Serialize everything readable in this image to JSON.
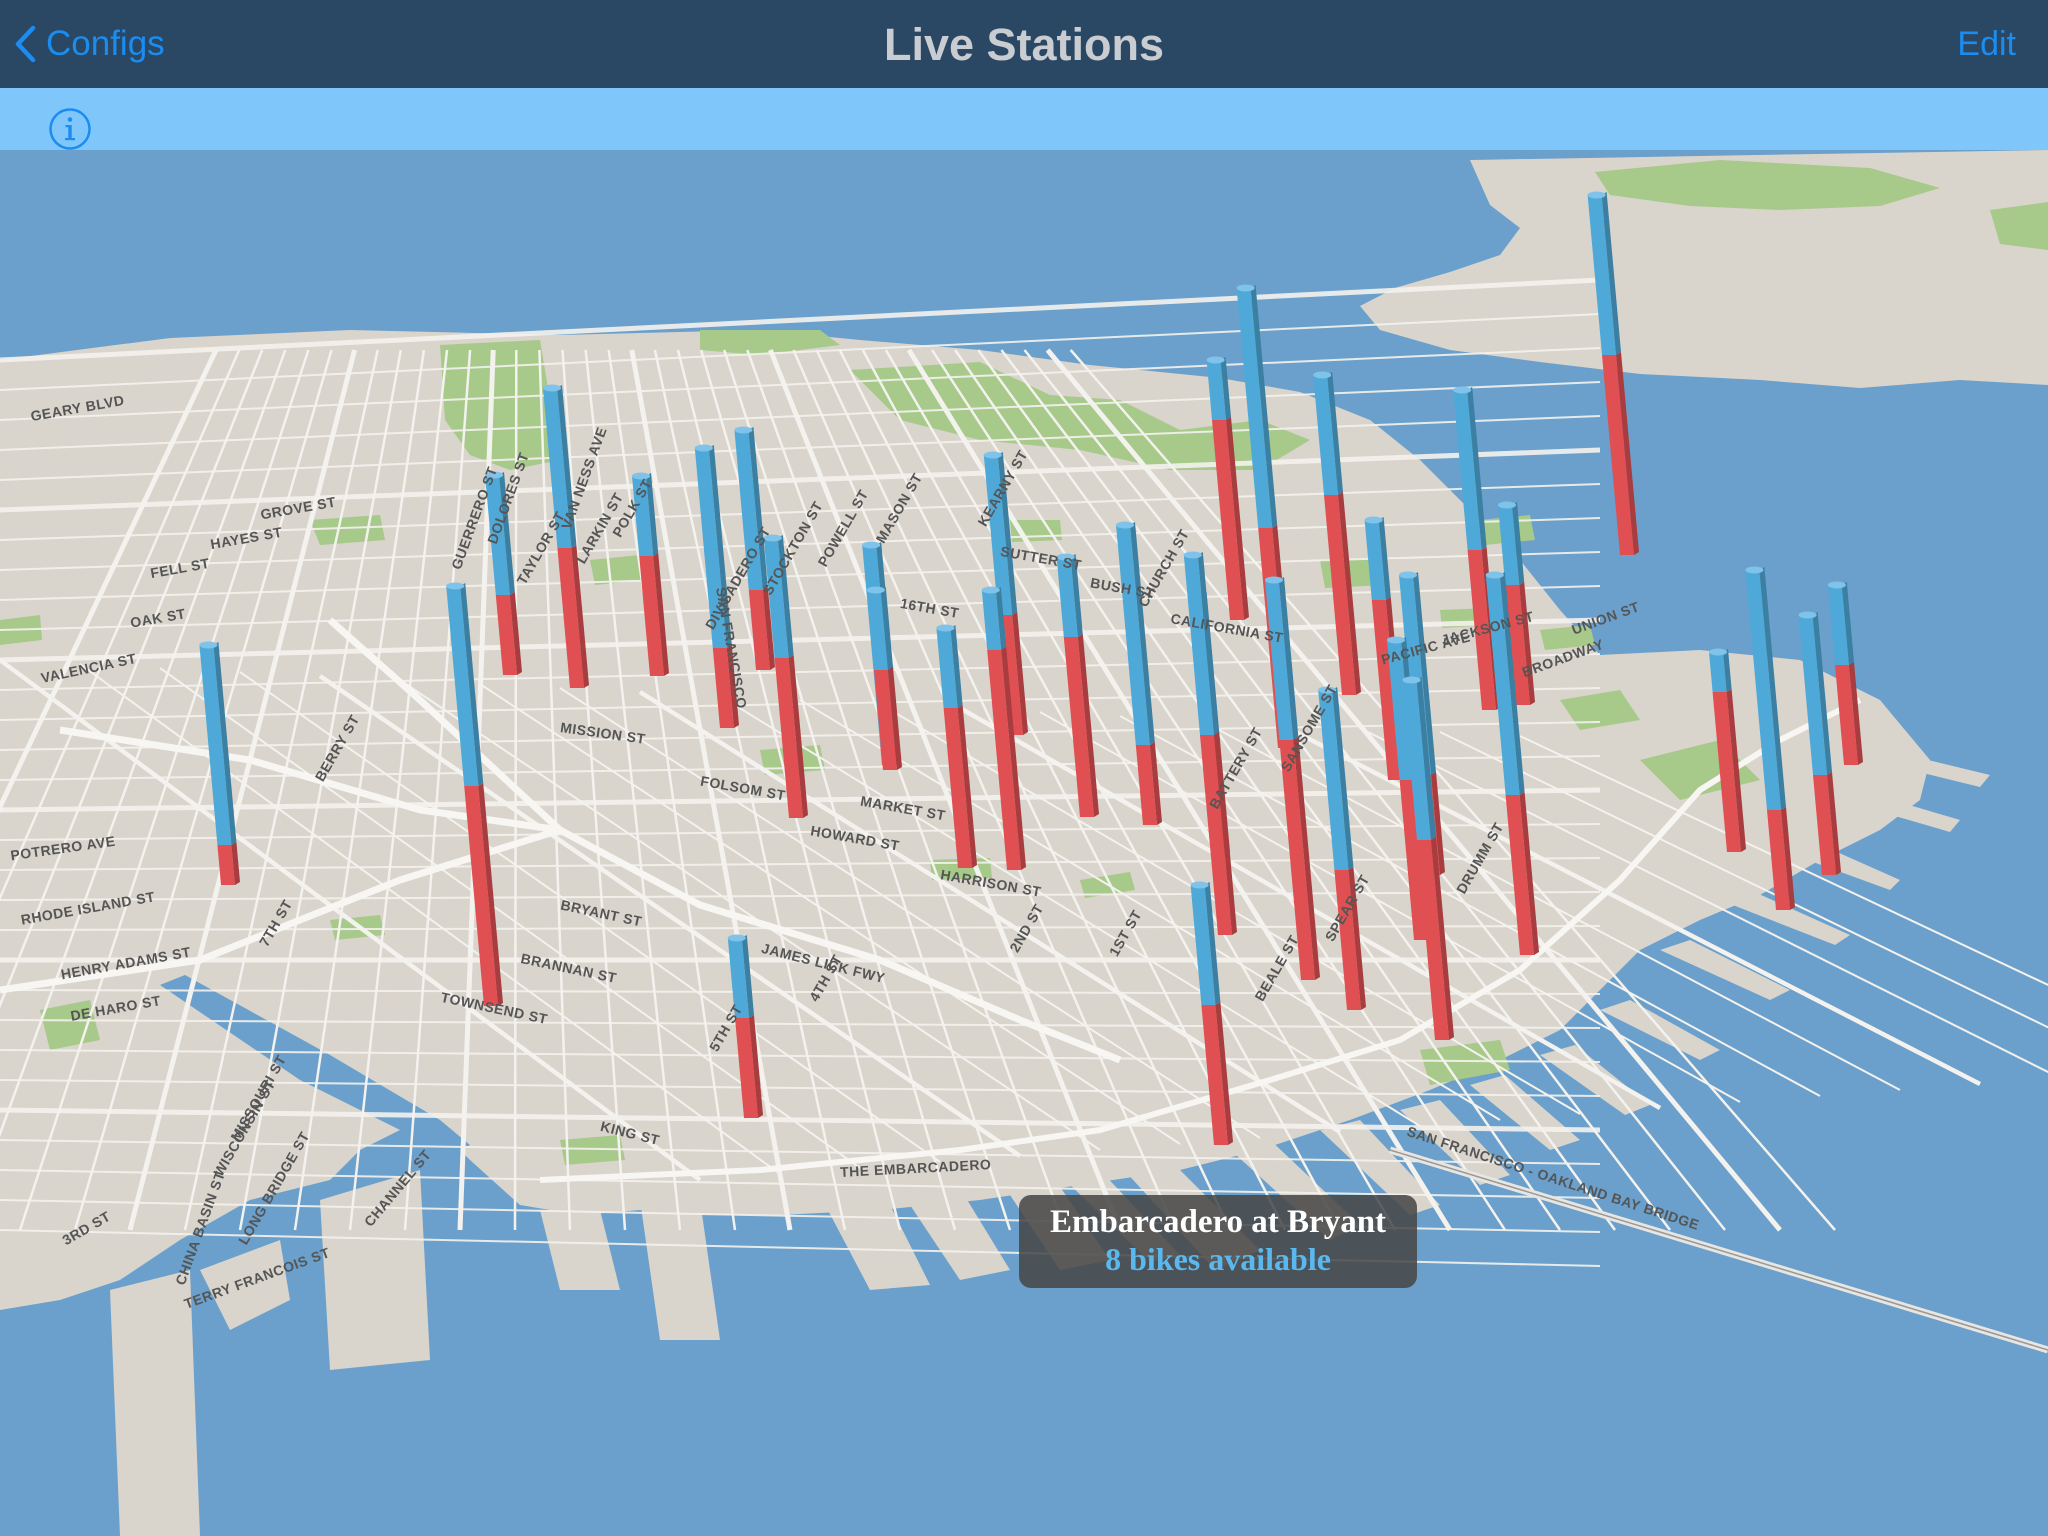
{
  "navbar": {
    "back_label": "Configs",
    "title": "Live Stations",
    "edit_label": "Edit"
  },
  "info": {
    "icon": "info-icon"
  },
  "map": {
    "street_labels": [
      "VALENCIA ST",
      "MISSION ST",
      "HOWARD ST",
      "BRYANT ST",
      "BRANNAN ST",
      "TOWNSEND ST",
      "KING ST",
      "THE EMBARCADERO",
      "FOLSOM ST",
      "HARRISON ST",
      "POTRERO AVE",
      "3RD ST",
      "SAN FRANCISCO - OAKLAND BAY BRIDGE",
      "JAMES LICK FWY",
      "MARKET ST",
      "1ST ST",
      "2ND ST",
      "4TH ST",
      "5TH ST",
      "7TH ST",
      "16TH ST",
      "CHANNEL ST",
      "TERRY FRANCOIS ST",
      "BEALE ST",
      "SPEAR ST",
      "DRUMM ST",
      "BATTERY ST",
      "SANSOME ST",
      "UNION ST",
      "JACKSON ST",
      "BROADWAY",
      "PACIFIC AVE",
      "SUTTER ST",
      "BUSH ST",
      "CALIFORNIA ST",
      "FELL ST",
      "OAK ST",
      "HAYES ST",
      "GROVE ST",
      "GEARY BLVD",
      "RHODE ISLAND ST",
      "HENRY ADAMS ST",
      "DE HARO ST",
      "WISCONSIN ST",
      "MISSOURI ST",
      "CHINA BASIN ST",
      "LONG BRIDGE ST",
      "BERRY ST",
      "DIVISADERO ST",
      "STOCKTON ST",
      "POWELL ST",
      "MASON ST",
      "TAYLOR ST",
      "LARKIN ST",
      "POLK ST",
      "VAN NESS AVE",
      "DOLORES ST",
      "GUERRERO ST",
      "CHURCH ST",
      "KEARNY ST",
      "SAN FRANCISCO"
    ],
    "callout": {
      "title": "Embarcadero at Bryant",
      "subtitle": "8 bikes available"
    },
    "colors": {
      "water": "#6aa0cb",
      "land": "#d9d4cc",
      "park": "#a7c98a",
      "bikes": "#4fa9d8",
      "docks": "#e05052"
    },
    "stations": [
      {
        "bikes": 6,
        "docks": 4
      },
      {
        "bikes": 8,
        "docks": 7
      },
      {
        "bikes": 4,
        "docks": 6
      },
      {
        "bikes": 10,
        "docks": 4
      },
      {
        "bikes": 8,
        "docks": 4
      },
      {
        "bikes": 6,
        "docks": 8
      },
      {
        "bikes": 4,
        "docks": 5
      },
      {
        "bikes": 10,
        "docks": 1
      },
      {
        "bikes": 4,
        "docks": 8
      },
      {
        "bikes": 8,
        "docks": 6
      },
      {
        "bikes": 3,
        "docks": 11
      },
      {
        "bikes": 4,
        "docks": 9
      },
      {
        "bikes": 11,
        "docks": 4
      },
      {
        "bikes": 7,
        "docks": 6
      },
      {
        "bikes": 9,
        "docks": 10
      },
      {
        "bikes": 3,
        "docks": 10
      },
      {
        "bikes": 12,
        "docks": 11
      },
      {
        "bikes": 6,
        "docks": 10
      },
      {
        "bikes": 4,
        "docks": 9
      },
      {
        "bikes": 8,
        "docks": 12
      },
      {
        "bikes": 7,
        "docks": 8
      },
      {
        "bikes": 10,
        "docks": 5
      },
      {
        "bikes": 8,
        "docks": 8
      },
      {
        "bikes": 4,
        "docks": 6
      },
      {
        "bikes": 8,
        "docks": 10
      },
      {
        "bikes": 2,
        "docks": 8
      },
      {
        "bikes": 12,
        "docks": 5
      },
      {
        "bikes": 8,
        "docks": 5
      },
      {
        "bikes": 4,
        "docks": 5
      },
      {
        "bikes": 11,
        "docks": 8
      },
      {
        "bikes": 8,
        "docks": 10
      },
      {
        "bikes": 9,
        "docks": 7
      },
      {
        "bikes": 6,
        "docks": 7
      },
      {
        "bikes": 4,
        "docks": 5
      },
      {
        "bikes": 10,
        "docks": 2
      },
      {
        "bikes": 10,
        "docks": 11
      }
    ]
  }
}
